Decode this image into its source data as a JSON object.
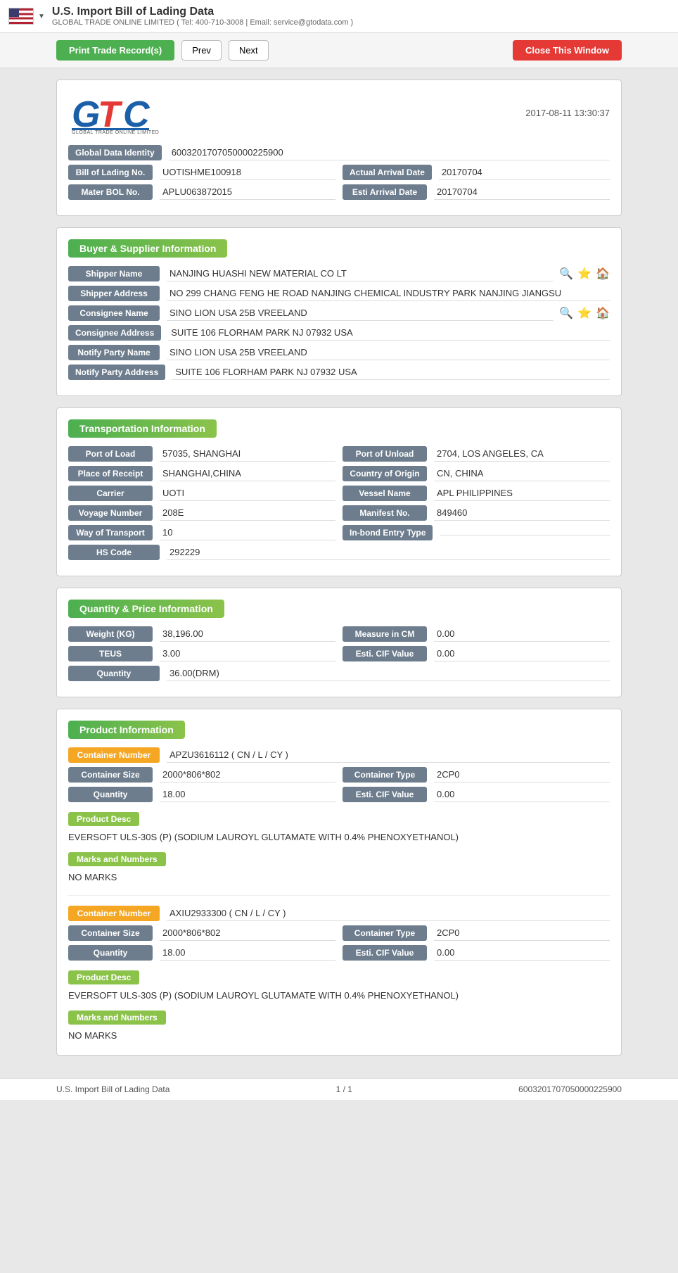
{
  "topbar": {
    "title": "U.S. Import Bill of Lading Data",
    "subtitle": "GLOBAL TRADE ONLINE LIMITED ( Tel: 400-710-3008 | Email: service@gtodata.com )"
  },
  "toolbar": {
    "print_label": "Print Trade Record(s)",
    "prev_label": "Prev",
    "next_label": "Next",
    "close_label": "Close This Window"
  },
  "header": {
    "logo_company": "GLOBAL TRADE ONLINE LIMITED",
    "datetime": "2017-08-11 13:30:37"
  },
  "global_data": {
    "label": "Global Data Identity",
    "value": "6003201707050000225900"
  },
  "bill_of_lading": {
    "label": "Bill of Lading No.",
    "value": "UOTISHME100918",
    "actual_arrival_date_label": "Actual Arrival Date",
    "actual_arrival_date_value": "20170704"
  },
  "master_bol": {
    "label": "Mater BOL No.",
    "value": "APLU063872015",
    "esti_arrival_date_label": "Esti Arrival Date",
    "esti_arrival_date_value": "20170704"
  },
  "buyer_supplier": {
    "section_title": "Buyer & Supplier Information",
    "shipper_name_label": "Shipper Name",
    "shipper_name_value": "NANJING HUASHI NEW MATERIAL CO LT",
    "shipper_address_label": "Shipper Address",
    "shipper_address_value": "NO 299 CHANG FENG HE ROAD NANJING CHEMICAL INDUSTRY PARK NANJING JIANGSU",
    "consignee_name_label": "Consignee Name",
    "consignee_name_value": "SINO LION USA 25B VREELAND",
    "consignee_address_label": "Consignee Address",
    "consignee_address_value": "SUITE 106 FLORHAM PARK NJ 07932 USA",
    "notify_party_name_label": "Notify Party Name",
    "notify_party_name_value": "SINO LION USA 25B VREELAND",
    "notify_party_address_label": "Notify Party Address",
    "notify_party_address_value": "SUITE 106 FLORHAM PARK NJ 07932 USA"
  },
  "transportation": {
    "section_title": "Transportation Information",
    "port_of_load_label": "Port of Load",
    "port_of_load_value": "57035, SHANGHAI",
    "port_of_unload_label": "Port of Unload",
    "port_of_unload_value": "2704, LOS ANGELES, CA",
    "place_of_receipt_label": "Place of Receipt",
    "place_of_receipt_value": "SHANGHAI,CHINA",
    "country_of_origin_label": "Country of Origin",
    "country_of_origin_value": "CN, CHINA",
    "carrier_label": "Carrier",
    "carrier_value": "UOTI",
    "vessel_name_label": "Vessel Name",
    "vessel_name_value": "APL PHILIPPINES",
    "voyage_number_label": "Voyage Number",
    "voyage_number_value": "208E",
    "manifest_no_label": "Manifest No.",
    "manifest_no_value": "849460",
    "way_of_transport_label": "Way of Transport",
    "way_of_transport_value": "10",
    "in_bond_entry_type_label": "In-bond Entry Type",
    "in_bond_entry_type_value": "",
    "hs_code_label": "HS Code",
    "hs_code_value": "292229"
  },
  "quantity_price": {
    "section_title": "Quantity & Price Information",
    "weight_label": "Weight (KG)",
    "weight_value": "38,196.00",
    "measure_label": "Measure in CM",
    "measure_value": "0.00",
    "teus_label": "TEUS",
    "teus_value": "3.00",
    "esti_cif_label": "Esti. CIF Value",
    "esti_cif_value": "0.00",
    "quantity_label": "Quantity",
    "quantity_value": "36.00(DRM)"
  },
  "product_information": {
    "section_title": "Product Information",
    "containers": [
      {
        "container_number_label": "Container Number",
        "container_number_value": "APZU3616112 ( CN / L / CY )",
        "container_size_label": "Container Size",
        "container_size_value": "2000*806*802",
        "container_type_label": "Container Type",
        "container_type_value": "2CP0",
        "quantity_label": "Quantity",
        "quantity_value": "18.00",
        "esti_cif_label": "Esti. CIF Value",
        "esti_cif_value": "0.00",
        "product_desc_label": "Product Desc",
        "product_desc_text": "EVERSOFT ULS-30S (P) (SODIUM LAUROYL GLUTAMATE WITH 0.4% PHENOXYETHANOL)",
        "marks_label": "Marks and Numbers",
        "marks_text": "NO MARKS"
      },
      {
        "container_number_label": "Container Number",
        "container_number_value": "AXIU2933300 ( CN / L / CY )",
        "container_size_label": "Container Size",
        "container_size_value": "2000*806*802",
        "container_type_label": "Container Type",
        "container_type_value": "2CP0",
        "quantity_label": "Quantity",
        "quantity_value": "18.00",
        "esti_cif_label": "Esti. CIF Value",
        "esti_cif_value": "0.00",
        "product_desc_label": "Product Desc",
        "product_desc_text": "EVERSOFT ULS-30S (P) (SODIUM LAUROYL GLUTAMATE WITH 0.4% PHENOXYETHANOL)",
        "marks_label": "Marks and Numbers",
        "marks_text": "NO MARKS"
      }
    ]
  },
  "footer": {
    "left": "U.S. Import Bill of Lading Data",
    "center": "1 / 1",
    "right": "6003201707050000225900"
  }
}
